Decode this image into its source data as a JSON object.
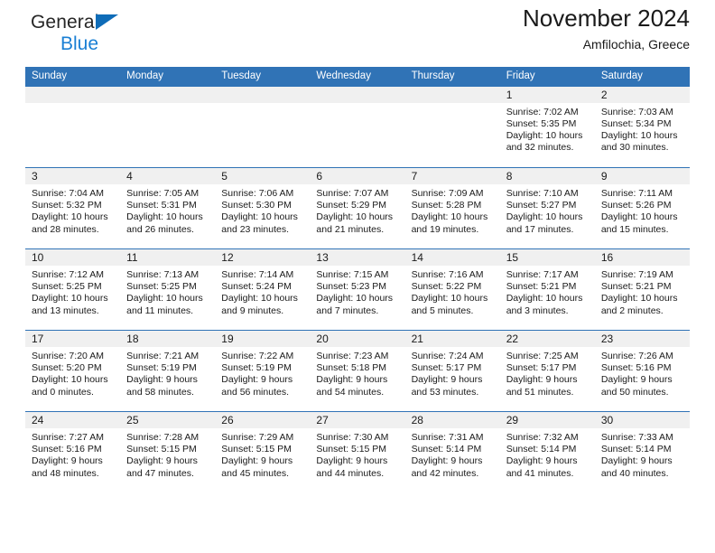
{
  "brand": {
    "name_top": "General",
    "name_bottom": "Blue",
    "triangle_color": "#0f6cb8",
    "text_color": "#262626",
    "accent_color": "#1a7fd4"
  },
  "header": {
    "title": "November 2024",
    "subtitle": "Amfilochia, Greece"
  },
  "theme": {
    "header_blue": "#3073b6",
    "daynum_band": "#f0f0f0",
    "text": "#1a1a1a"
  },
  "calendar": {
    "weekday_headers": [
      "Sunday",
      "Monday",
      "Tuesday",
      "Wednesday",
      "Thursday",
      "Friday",
      "Saturday"
    ],
    "weeks": [
      [
        {
          "day": "",
          "sunrise": "",
          "sunset": "",
          "daylight_line1": "",
          "daylight_line2": ""
        },
        {
          "day": "",
          "sunrise": "",
          "sunset": "",
          "daylight_line1": "",
          "daylight_line2": ""
        },
        {
          "day": "",
          "sunrise": "",
          "sunset": "",
          "daylight_line1": "",
          "daylight_line2": ""
        },
        {
          "day": "",
          "sunrise": "",
          "sunset": "",
          "daylight_line1": "",
          "daylight_line2": ""
        },
        {
          "day": "",
          "sunrise": "",
          "sunset": "",
          "daylight_line1": "",
          "daylight_line2": ""
        },
        {
          "day": "1",
          "sunrise": "Sunrise: 7:02 AM",
          "sunset": "Sunset: 5:35 PM",
          "daylight_line1": "Daylight: 10 hours",
          "daylight_line2": "and 32 minutes."
        },
        {
          "day": "2",
          "sunrise": "Sunrise: 7:03 AM",
          "sunset": "Sunset: 5:34 PM",
          "daylight_line1": "Daylight: 10 hours",
          "daylight_line2": "and 30 minutes."
        }
      ],
      [
        {
          "day": "3",
          "sunrise": "Sunrise: 7:04 AM",
          "sunset": "Sunset: 5:32 PM",
          "daylight_line1": "Daylight: 10 hours",
          "daylight_line2": "and 28 minutes."
        },
        {
          "day": "4",
          "sunrise": "Sunrise: 7:05 AM",
          "sunset": "Sunset: 5:31 PM",
          "daylight_line1": "Daylight: 10 hours",
          "daylight_line2": "and 26 minutes."
        },
        {
          "day": "5",
          "sunrise": "Sunrise: 7:06 AM",
          "sunset": "Sunset: 5:30 PM",
          "daylight_line1": "Daylight: 10 hours",
          "daylight_line2": "and 23 minutes."
        },
        {
          "day": "6",
          "sunrise": "Sunrise: 7:07 AM",
          "sunset": "Sunset: 5:29 PM",
          "daylight_line1": "Daylight: 10 hours",
          "daylight_line2": "and 21 minutes."
        },
        {
          "day": "7",
          "sunrise": "Sunrise: 7:09 AM",
          "sunset": "Sunset: 5:28 PM",
          "daylight_line1": "Daylight: 10 hours",
          "daylight_line2": "and 19 minutes."
        },
        {
          "day": "8",
          "sunrise": "Sunrise: 7:10 AM",
          "sunset": "Sunset: 5:27 PM",
          "daylight_line1": "Daylight: 10 hours",
          "daylight_line2": "and 17 minutes."
        },
        {
          "day": "9",
          "sunrise": "Sunrise: 7:11 AM",
          "sunset": "Sunset: 5:26 PM",
          "daylight_line1": "Daylight: 10 hours",
          "daylight_line2": "and 15 minutes."
        }
      ],
      [
        {
          "day": "10",
          "sunrise": "Sunrise: 7:12 AM",
          "sunset": "Sunset: 5:25 PM",
          "daylight_line1": "Daylight: 10 hours",
          "daylight_line2": "and 13 minutes."
        },
        {
          "day": "11",
          "sunrise": "Sunrise: 7:13 AM",
          "sunset": "Sunset: 5:25 PM",
          "daylight_line1": "Daylight: 10 hours",
          "daylight_line2": "and 11 minutes."
        },
        {
          "day": "12",
          "sunrise": "Sunrise: 7:14 AM",
          "sunset": "Sunset: 5:24 PM",
          "daylight_line1": "Daylight: 10 hours",
          "daylight_line2": "and 9 minutes."
        },
        {
          "day": "13",
          "sunrise": "Sunrise: 7:15 AM",
          "sunset": "Sunset: 5:23 PM",
          "daylight_line1": "Daylight: 10 hours",
          "daylight_line2": "and 7 minutes."
        },
        {
          "day": "14",
          "sunrise": "Sunrise: 7:16 AM",
          "sunset": "Sunset: 5:22 PM",
          "daylight_line1": "Daylight: 10 hours",
          "daylight_line2": "and 5 minutes."
        },
        {
          "day": "15",
          "sunrise": "Sunrise: 7:17 AM",
          "sunset": "Sunset: 5:21 PM",
          "daylight_line1": "Daylight: 10 hours",
          "daylight_line2": "and 3 minutes."
        },
        {
          "day": "16",
          "sunrise": "Sunrise: 7:19 AM",
          "sunset": "Sunset: 5:21 PM",
          "daylight_line1": "Daylight: 10 hours",
          "daylight_line2": "and 2 minutes."
        }
      ],
      [
        {
          "day": "17",
          "sunrise": "Sunrise: 7:20 AM",
          "sunset": "Sunset: 5:20 PM",
          "daylight_line1": "Daylight: 10 hours",
          "daylight_line2": "and 0 minutes."
        },
        {
          "day": "18",
          "sunrise": "Sunrise: 7:21 AM",
          "sunset": "Sunset: 5:19 PM",
          "daylight_line1": "Daylight: 9 hours",
          "daylight_line2": "and 58 minutes."
        },
        {
          "day": "19",
          "sunrise": "Sunrise: 7:22 AM",
          "sunset": "Sunset: 5:19 PM",
          "daylight_line1": "Daylight: 9 hours",
          "daylight_line2": "and 56 minutes."
        },
        {
          "day": "20",
          "sunrise": "Sunrise: 7:23 AM",
          "sunset": "Sunset: 5:18 PM",
          "daylight_line1": "Daylight: 9 hours",
          "daylight_line2": "and 54 minutes."
        },
        {
          "day": "21",
          "sunrise": "Sunrise: 7:24 AM",
          "sunset": "Sunset: 5:17 PM",
          "daylight_line1": "Daylight: 9 hours",
          "daylight_line2": "and 53 minutes."
        },
        {
          "day": "22",
          "sunrise": "Sunrise: 7:25 AM",
          "sunset": "Sunset: 5:17 PM",
          "daylight_line1": "Daylight: 9 hours",
          "daylight_line2": "and 51 minutes."
        },
        {
          "day": "23",
          "sunrise": "Sunrise: 7:26 AM",
          "sunset": "Sunset: 5:16 PM",
          "daylight_line1": "Daylight: 9 hours",
          "daylight_line2": "and 50 minutes."
        }
      ],
      [
        {
          "day": "24",
          "sunrise": "Sunrise: 7:27 AM",
          "sunset": "Sunset: 5:16 PM",
          "daylight_line1": "Daylight: 9 hours",
          "daylight_line2": "and 48 minutes."
        },
        {
          "day": "25",
          "sunrise": "Sunrise: 7:28 AM",
          "sunset": "Sunset: 5:15 PM",
          "daylight_line1": "Daylight: 9 hours",
          "daylight_line2": "and 47 minutes."
        },
        {
          "day": "26",
          "sunrise": "Sunrise: 7:29 AM",
          "sunset": "Sunset: 5:15 PM",
          "daylight_line1": "Daylight: 9 hours",
          "daylight_line2": "and 45 minutes."
        },
        {
          "day": "27",
          "sunrise": "Sunrise: 7:30 AM",
          "sunset": "Sunset: 5:15 PM",
          "daylight_line1": "Daylight: 9 hours",
          "daylight_line2": "and 44 minutes."
        },
        {
          "day": "28",
          "sunrise": "Sunrise: 7:31 AM",
          "sunset": "Sunset: 5:14 PM",
          "daylight_line1": "Daylight: 9 hours",
          "daylight_line2": "and 42 minutes."
        },
        {
          "day": "29",
          "sunrise": "Sunrise: 7:32 AM",
          "sunset": "Sunset: 5:14 PM",
          "daylight_line1": "Daylight: 9 hours",
          "daylight_line2": "and 41 minutes."
        },
        {
          "day": "30",
          "sunrise": "Sunrise: 7:33 AM",
          "sunset": "Sunset: 5:14 PM",
          "daylight_line1": "Daylight: 9 hours",
          "daylight_line2": "and 40 minutes."
        }
      ]
    ]
  }
}
